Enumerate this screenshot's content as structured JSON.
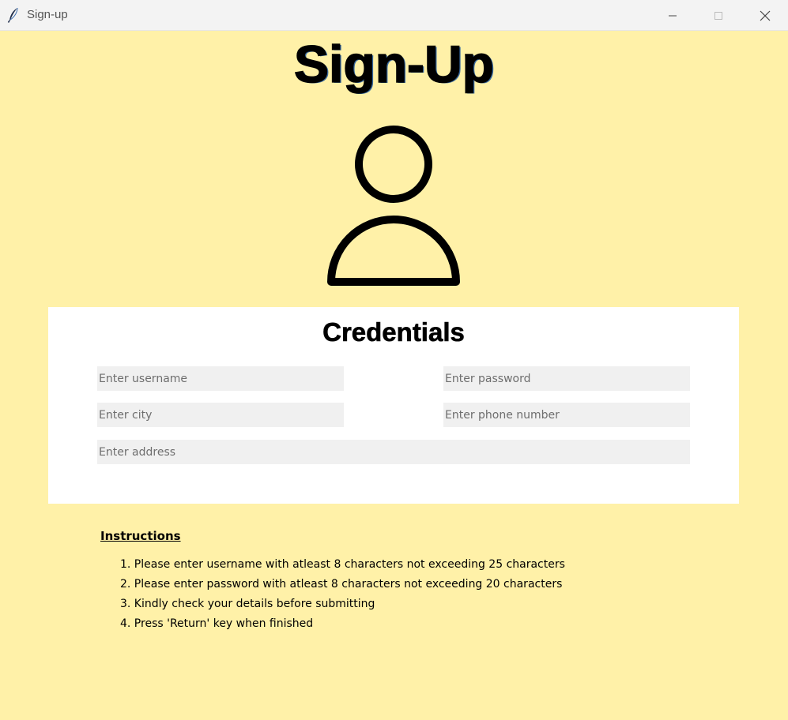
{
  "window": {
    "title": "Sign-up",
    "icon": "feather-icon",
    "background_color": "#fff1a8"
  },
  "header": {
    "title": "Sign-Up",
    "avatar_icon": "user-icon"
  },
  "credentials": {
    "title": "Credentials",
    "fields": {
      "username": {
        "placeholder": "Enter username",
        "value": ""
      },
      "password": {
        "placeholder": "Enter password",
        "value": ""
      },
      "city": {
        "placeholder": "Enter city",
        "value": ""
      },
      "phone": {
        "placeholder": "Enter phone number",
        "value": ""
      },
      "address": {
        "placeholder": "Enter address",
        "value": ""
      }
    }
  },
  "instructions": {
    "heading": "Instructions",
    "items": [
      "1. Please enter username with atleast 8 characters not exceeding 25 characters",
      "2. Please enter password with atleast 8 characters not exceeding 20 characters",
      "3. Kindly check your details before submitting",
      "4. Press 'Return' key when finished"
    ]
  }
}
